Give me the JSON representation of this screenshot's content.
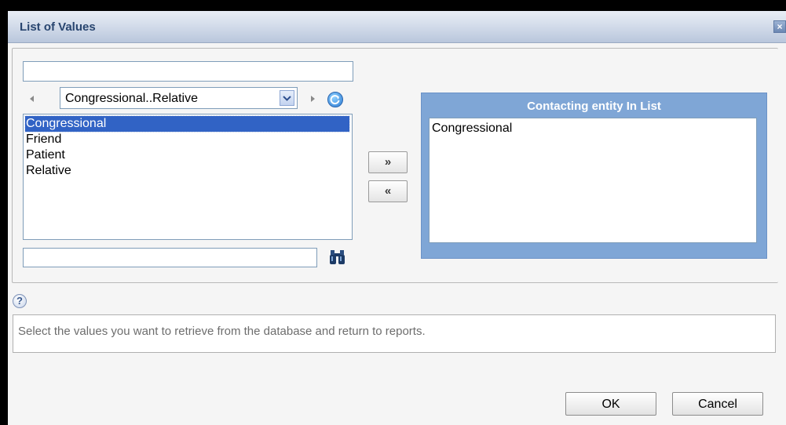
{
  "dialog": {
    "title": "List of Values",
    "close_glyph": "×"
  },
  "filter": {
    "value": "",
    "placeholder": ""
  },
  "range_selector": {
    "selected": "Congressional..Relative",
    "prev_icon": "left-arrow-icon",
    "next_icon": "right-arrow-icon",
    "refresh_icon": "refresh-icon"
  },
  "available_values": {
    "items": [
      {
        "label": "Congressional",
        "selected": true
      },
      {
        "label": "Friend",
        "selected": false
      },
      {
        "label": "Patient",
        "selected": false
      },
      {
        "label": "Relative",
        "selected": false
      }
    ]
  },
  "buttons": {
    "add": "»",
    "remove": "«",
    "ok": "OK",
    "cancel": "Cancel"
  },
  "selected_values": {
    "header": "Contacting entity In List",
    "items": [
      "Congressional"
    ]
  },
  "search": {
    "value": "",
    "placeholder": "",
    "icon": "binoculars-icon"
  },
  "help": {
    "icon_glyph": "?",
    "text": "Select the values you want to retrieve from the database and return to reports."
  },
  "colors": {
    "accent": "#7fa6d6",
    "selection": "#3163c5",
    "title_text": "#28456f"
  }
}
